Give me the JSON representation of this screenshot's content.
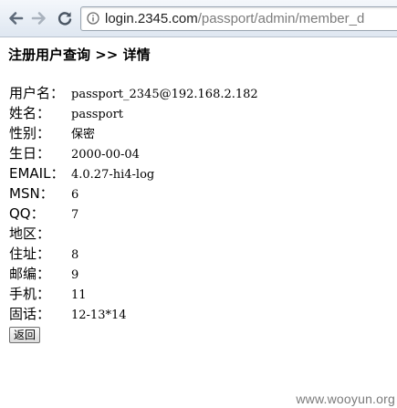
{
  "browser": {
    "url_host": "login.2345.com",
    "url_path": "/passport/admin/member_d"
  },
  "page": {
    "title": "注册用户查询 >> 详情",
    "fields": [
      {
        "label": "用户名：",
        "value": "passport_2345@192.168.2.182"
      },
      {
        "label": "姓名：",
        "value": "passport"
      },
      {
        "label": "性别：",
        "value": "保密"
      },
      {
        "label": "生日：",
        "value": "2000-00-04"
      },
      {
        "label": "EMAIL：",
        "value": "4.0.27-hi4-log"
      },
      {
        "label": "MSN：",
        "value": "6"
      },
      {
        "label": "QQ：",
        "value": "7"
      },
      {
        "label": "地区：",
        "value": ""
      },
      {
        "label": "住址：",
        "value": "8"
      },
      {
        "label": "邮编：",
        "value": "9"
      },
      {
        "label": "手机：",
        "value": "11"
      },
      {
        "label": "固话：",
        "value": "12-13*14"
      }
    ],
    "back_button_label": "返回"
  },
  "watermark": "www.wooyun.org",
  "icons": {
    "back": "arrow-left-icon",
    "forward": "arrow-right-icon",
    "reload": "reload-icon",
    "page": "page-icon"
  }
}
